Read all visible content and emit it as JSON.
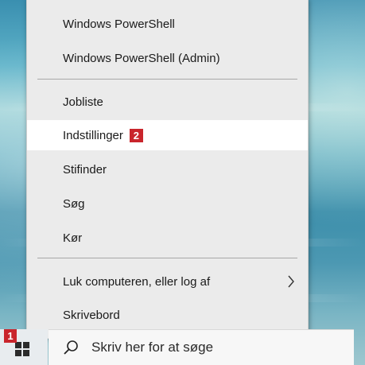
{
  "menu": {
    "items": [
      {
        "label": "Windows PowerShell"
      },
      {
        "label": "Windows PowerShell (Admin)"
      },
      {
        "label": "Jobliste"
      },
      {
        "label": "Indstillinger",
        "badge": "2"
      },
      {
        "label": "Stifinder"
      },
      {
        "label": "Søg"
      },
      {
        "label": "Kør"
      },
      {
        "label": "Luk computeren, eller log af",
        "icon": "chevron-right-icon"
      },
      {
        "label": "Skrivebord"
      }
    ],
    "highlighted_item": "Indstillinger"
  },
  "taskbar": {
    "start_badge": "1",
    "start_icon": "windows-logo-icon",
    "search": {
      "placeholder": "Skriv her for at søge",
      "icon": "search-icon"
    }
  },
  "colors": {
    "badge_red": "#c9252c",
    "menu_bg": "#ebebeb",
    "highlight_bg": "#ffffff"
  }
}
